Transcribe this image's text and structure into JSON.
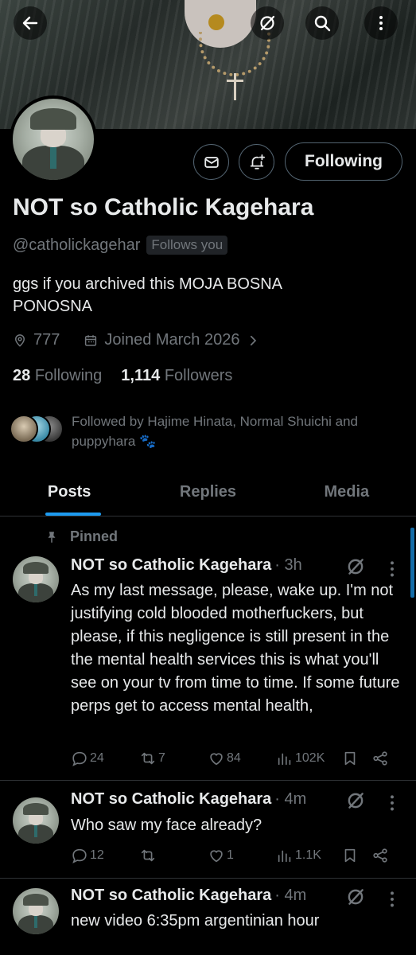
{
  "header": {
    "back_icon": "arrow-left-icon",
    "grok_icon": "grok-icon",
    "search_icon": "search-icon",
    "more_icon": "more-vertical-icon"
  },
  "profile": {
    "name": "NOT so Catholic Kagehara",
    "handle": "@catholickagehar",
    "follows_you": "Follows you",
    "bio": "ggs if you archived this  MOJA BOSNA PONOSNA",
    "location": "777",
    "joined": "Joined March 2026",
    "following_count": "28",
    "following_label": "Following",
    "followers_count": "1,114",
    "followers_label": "Followers",
    "following_button": "Following",
    "followed_by": "Followed by Hajime Hinata, Normal Shuichi and puppyhara 🐾"
  },
  "tabs": [
    {
      "label": "Posts"
    },
    {
      "label": "Replies"
    },
    {
      "label": "Media"
    }
  ],
  "pinned_label": "Pinned",
  "posts": [
    {
      "name": "NOT so Catholic Kagehara",
      "time": "· 3h",
      "text": "As my last message, please, wake up. I'm not justifying cold blooded motherfuckers, but please, if this negligence is still present in the the mental health services this is what you'll see on your tv from time to time. If some future perps get to access mental health,",
      "replies": "24",
      "reposts": "7",
      "likes": "84",
      "views": "102K"
    },
    {
      "name": "NOT so Catholic Kagehara",
      "time": "· 4m",
      "text": "Who saw my face already?",
      "replies": "12",
      "reposts": "",
      "likes": "1",
      "views": "1.1K"
    },
    {
      "name": "NOT so Catholic Kagehara",
      "time": "· 4m",
      "text": "new video 6:35pm argentinian hour"
    }
  ],
  "colors": {
    "accent": "#1d9bf0",
    "muted": "#71767b",
    "border": "#2f3336",
    "text": "#e7e9ea"
  }
}
